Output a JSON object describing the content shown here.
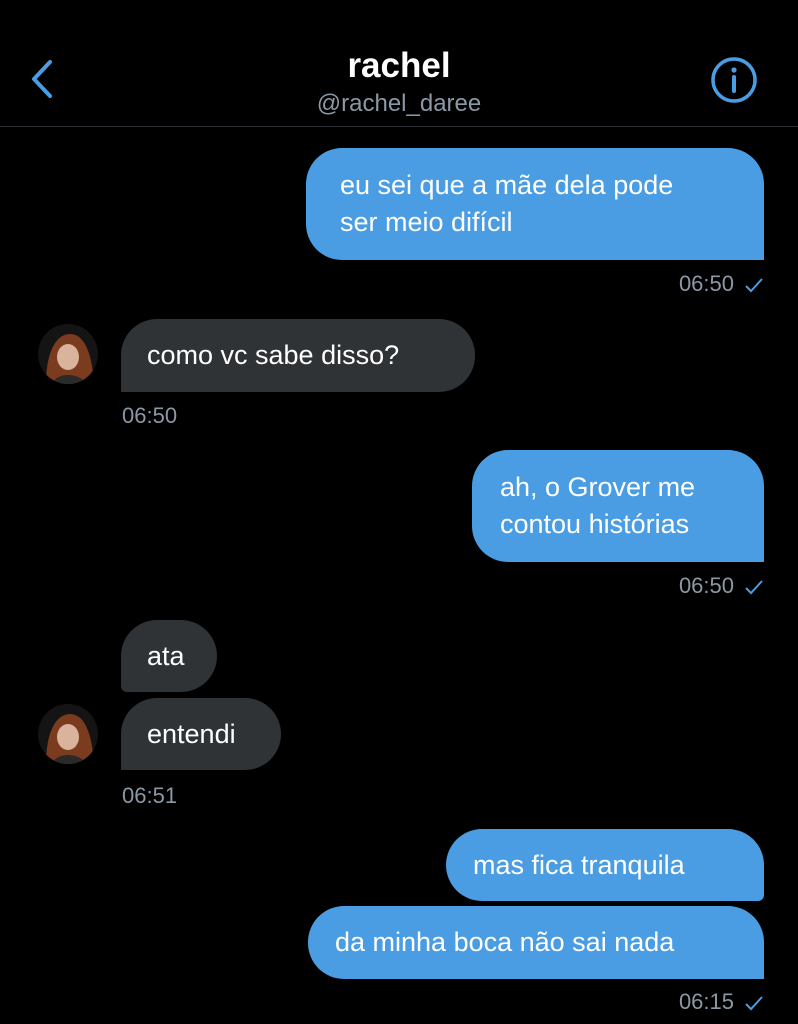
{
  "header": {
    "title": "rachel",
    "handle": "@rachel_daree",
    "back_icon": "chevron-left-icon",
    "info_icon": "info-circle-icon"
  },
  "colors": {
    "accent": "#4a9de3",
    "received_bubble": "#2f3336",
    "muted_text": "#8b98a5",
    "background": "#000000"
  },
  "messages": [
    {
      "id": "m1",
      "direction": "sent",
      "lines": [
        "eu sei que a mãe dela pode",
        "ser meio difícil"
      ],
      "time": "06:50",
      "read": true
    },
    {
      "id": "m2",
      "direction": "received",
      "lines": [
        "como vc sabe disso?"
      ],
      "time": "06:50"
    },
    {
      "id": "m3",
      "direction": "sent",
      "lines": [
        "ah, o Grover me",
        "contou histórias"
      ],
      "time": "06:50",
      "read": true
    },
    {
      "id": "m4",
      "direction": "received",
      "lines": [
        "ata"
      ]
    },
    {
      "id": "m5",
      "direction": "received",
      "lines": [
        "entendi"
      ],
      "time": "06:51"
    },
    {
      "id": "m6",
      "direction": "sent",
      "lines": [
        "mas fica tranquila"
      ]
    },
    {
      "id": "m7",
      "direction": "sent",
      "lines": [
        "da minha boca não sai nada"
      ],
      "time": "06:15",
      "read": true
    }
  ]
}
